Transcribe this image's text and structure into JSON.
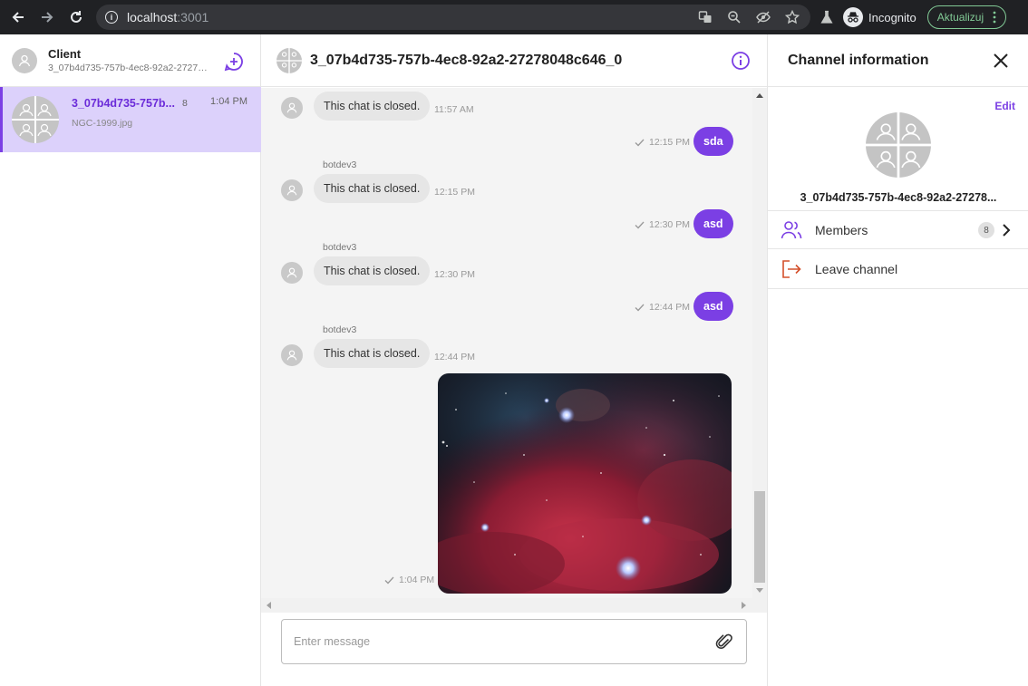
{
  "browser": {
    "url_host": "localhost",
    "url_port": ":3001",
    "profile_label": "Incognito",
    "update_label": "Aktualizuj"
  },
  "sidebar": {
    "user_name": "Client",
    "user_id": "3_07b4d735-757b-4ec8-92a2-27278048c646_0",
    "channels": [
      {
        "title": "3_07b4d735-757b...",
        "member_count": "8",
        "last_message": "NGC-1999.jpg",
        "time": "1:04 PM"
      }
    ]
  },
  "chat": {
    "title": "3_07b4d735-757b-4ec8-92a2-27278048c646_0",
    "messages": [
      {
        "text": "This chat is closed.",
        "time": "11:57 AM"
      },
      {
        "text": "sda",
        "time": "12:15 PM"
      },
      {
        "sender": "botdev3",
        "text": "This chat is closed.",
        "time": "12:15 PM"
      },
      {
        "text": "asd",
        "time": "12:30 PM"
      },
      {
        "sender": "botdev3",
        "text": "This chat is closed.",
        "time": "12:30 PM"
      },
      {
        "text": "asd",
        "time": "12:44 PM"
      },
      {
        "sender": "botdev3",
        "text": "This chat is closed.",
        "time": "12:44 PM"
      },
      {
        "time": "1:04 PM"
      }
    ],
    "composer_placeholder": "Enter message"
  },
  "info_panel": {
    "title": "Channel information",
    "edit_label": "Edit",
    "channel_name": "3_07b4d735-757b-4ec8-92a2-27278...",
    "members_label": "Members",
    "members_count": "8",
    "leave_label": "Leave channel"
  },
  "colors": {
    "accent": "#7b3fe4",
    "selected_bg": "#dcd1fb",
    "leave_icon": "#d4502b"
  }
}
